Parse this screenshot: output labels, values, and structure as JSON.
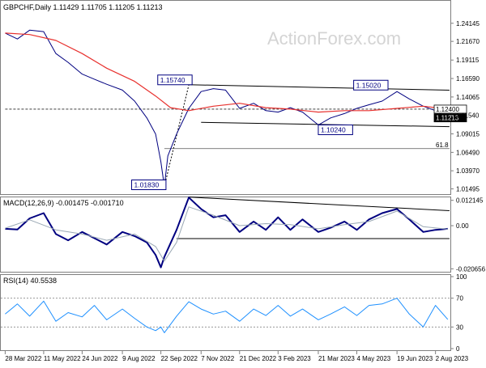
{
  "chart_data": [
    {
      "type": "line",
      "panel": "price",
      "title": "GBPCHF,Daily  1.11429 1.11705 1.11205 1.11213",
      "watermark": "ActionForex.com",
      "ylim": [
        1.01,
        1.26
      ],
      "y_ticks": [
        1.24145,
        1.2167,
        1.19115,
        1.1659,
        1.14065,
        1.1154,
        1.09015,
        1.0649,
        1.0397,
        1.01495
      ],
      "y_tick_labels": [
        "1.24145",
        "1.21670",
        "1.19115",
        "1.16590",
        "1.14065",
        "1.11540",
        "1.09015",
        "1.06490",
        "1.03970",
        "1.01495"
      ],
      "x_dates": [
        "28 Mar 2022",
        "11 May 2022",
        "24 Jun 2022",
        "9 Aug 2022",
        "22 Sep 2022",
        "7 Nov 2022",
        "21 Dec 2022",
        "3 Feb 2023",
        "21 Mar 2023",
        "4 May 2023",
        "19 Jun 2023",
        "2 Aug 2023"
      ],
      "series": [
        {
          "role": "close",
          "color": "#000080",
          "x": [
            "2022-03-28",
            "2022-04-11",
            "2022-04-25",
            "2022-05-11",
            "2022-05-25",
            "2022-06-08",
            "2022-06-24",
            "2022-07-08",
            "2022-07-22",
            "2022-08-09",
            "2022-08-23",
            "2022-09-06",
            "2022-09-16",
            "2022-09-22",
            "2022-09-26",
            "2022-09-30",
            "2022-10-10",
            "2022-10-24",
            "2022-11-07",
            "2022-11-21",
            "2022-12-05",
            "2022-12-21",
            "2023-01-06",
            "2023-01-20",
            "2023-02-03",
            "2023-02-17",
            "2023-03-03",
            "2023-03-21",
            "2023-04-04",
            "2023-04-20",
            "2023-05-04",
            "2023-05-18",
            "2023-06-02",
            "2023-06-19",
            "2023-07-03",
            "2023-07-19",
            "2023-08-02",
            "2023-08-16"
          ],
          "y": [
            1.228,
            1.22,
            1.232,
            1.23,
            1.2,
            1.188,
            1.172,
            1.165,
            1.158,
            1.15,
            1.135,
            1.112,
            1.09,
            1.052,
            1.0183,
            1.06,
            1.09,
            1.125,
            1.148,
            1.152,
            1.15,
            1.125,
            1.132,
            1.122,
            1.12,
            1.126,
            1.12,
            1.1024,
            1.112,
            1.118,
            1.125,
            1.13,
            1.135,
            1.148,
            1.138,
            1.128,
            1.122,
            1.1121
          ]
        },
        {
          "role": "moving average",
          "color": "#e8312e",
          "x": [
            "2022-03-28",
            "2022-04-25",
            "2022-05-25",
            "2022-06-24",
            "2022-07-22",
            "2022-08-23",
            "2022-09-16",
            "2022-10-03",
            "2022-10-24",
            "2022-11-21",
            "2022-12-21",
            "2023-01-20",
            "2023-02-17",
            "2023-03-21",
            "2023-04-20",
            "2023-05-18",
            "2023-06-19",
            "2023-07-19",
            "2023-08-16"
          ],
          "y": [
            1.228,
            1.226,
            1.218,
            1.2,
            1.18,
            1.162,
            1.142,
            1.126,
            1.122,
            1.128,
            1.132,
            1.126,
            1.124,
            1.12,
            1.122,
            1.122,
            1.125,
            1.128,
            1.124
          ]
        }
      ],
      "labels": [
        {
          "text": "1.15740",
          "date": "2022-10-24",
          "value": 1.1574
        },
        {
          "text": "1.01830",
          "date": "2022-09-26",
          "value": 1.0183
        },
        {
          "text": "1.15020",
          "date": "2023-06-05",
          "value": 1.1502
        },
        {
          "text": "1.10240",
          "date": "2023-03-21",
          "value": 1.1024
        },
        {
          "text": "61.8",
          "date": "2023-08-16",
          "value": 1.07
        }
      ],
      "price_tags": [
        {
          "text": "1.12400",
          "value": 1.124,
          "style": "light"
        },
        {
          "text": "1.11213",
          "value": 1.11213,
          "style": "dark"
        }
      ],
      "lines": [
        {
          "role": "channel-upper",
          "from": {
            "date": "2022-10-24",
            "value": 1.1574
          },
          "to": {
            "date": "2023-08-18",
            "value": 1.15
          }
        },
        {
          "role": "channel-lower",
          "from": {
            "date": "2022-11-07",
            "value": 1.106
          },
          "to": {
            "date": "2023-08-18",
            "value": 1.1
          }
        },
        {
          "role": "trend-support",
          "from": {
            "date": "2022-09-26",
            "value": 1.0183
          },
          "to": {
            "date": "2022-10-24",
            "value": 1.1574
          }
        },
        {
          "role": "fib-61.8",
          "from": {
            "date": "2022-09-26",
            "value": 1.07
          },
          "to": {
            "date": "2023-08-18",
            "value": 1.07
          }
        },
        {
          "role": "current-level",
          "from": {
            "date": "2022-03-28",
            "value": 1.124
          },
          "to": {
            "date": "2023-08-18",
            "value": 1.124
          }
        }
      ]
    },
    {
      "type": "line",
      "panel": "macd",
      "title": "MACD(12,26,9) -0.001475 -0.001710",
      "ylim": [
        -0.0213,
        0.0128
      ],
      "y_ticks": [
        0.012145,
        0.0,
        -0.020656
      ],
      "y_tick_labels": [
        "0.012145",
        "0.00",
        "-0.020656"
      ],
      "series": [
        {
          "role": "macd",
          "color": "#000080",
          "x": [
            "2022-03-28",
            "2022-04-11",
            "2022-04-25",
            "2022-05-11",
            "2022-05-25",
            "2022-06-08",
            "2022-06-24",
            "2022-07-08",
            "2022-07-22",
            "2022-08-09",
            "2022-08-23",
            "2022-09-06",
            "2022-09-16",
            "2022-09-22",
            "2022-09-26",
            "2022-10-10",
            "2022-10-24",
            "2022-11-07",
            "2022-11-21",
            "2022-12-05",
            "2022-12-21",
            "2023-01-06",
            "2023-01-20",
            "2023-02-03",
            "2023-02-17",
            "2023-03-03",
            "2023-03-21",
            "2023-04-04",
            "2023-04-20",
            "2023-05-04",
            "2023-05-18",
            "2023-06-02",
            "2023-06-19",
            "2023-07-03",
            "2023-07-19",
            "2023-08-02",
            "2023-08-16"
          ],
          "y": [
            -0.0015,
            -0.0018,
            0.0035,
            0.006,
            -0.004,
            -0.007,
            -0.003,
            -0.006,
            -0.009,
            -0.003,
            -0.005,
            -0.008,
            -0.014,
            -0.02,
            -0.015,
            -0.002,
            0.0135,
            0.008,
            0.004,
            0.005,
            -0.003,
            0.002,
            -0.002,
            0.004,
            -0.002,
            0.003,
            -0.003,
            -0.001,
            0.002,
            -0.002,
            0.003,
            0.006,
            0.008,
            0.003,
            -0.003,
            -0.002,
            -0.0015
          ]
        },
        {
          "role": "signal",
          "color": "#9aa8b4",
          "x": [
            "2022-03-28",
            "2022-04-25",
            "2022-05-25",
            "2022-06-24",
            "2022-07-22",
            "2022-08-23",
            "2022-09-16",
            "2022-09-26",
            "2022-10-10",
            "2022-10-24",
            "2022-11-21",
            "2022-12-21",
            "2023-01-20",
            "2023-02-17",
            "2023-03-21",
            "2023-04-20",
            "2023-05-18",
            "2023-06-19",
            "2023-07-19",
            "2023-08-16"
          ],
          "y": [
            -0.0012,
            0.0028,
            -0.002,
            -0.004,
            -0.007,
            -0.004,
            -0.01,
            -0.017,
            -0.008,
            0.009,
            0.005,
            0.0,
            0.001,
            0.0005,
            -0.0015,
            0.0005,
            0.002,
            0.007,
            -0.0005,
            -0.0017
          ]
        }
      ],
      "lines": [
        {
          "role": "macd-resistance",
          "from": {
            "date": "2022-10-24",
            "value": 0.0137
          },
          "to": {
            "date": "2023-08-18",
            "value": 0.0072
          }
        },
        {
          "role": "macd-support",
          "from": {
            "date": "2022-10-10",
            "value": -0.0062
          },
          "to": {
            "date": "2023-08-18",
            "value": -0.0062
          }
        }
      ]
    },
    {
      "type": "line",
      "panel": "rsi",
      "title": "RSI(14) 40.5538",
      "ylim": [
        0,
        100
      ],
      "y_ticks": [
        100,
        70,
        30,
        0
      ],
      "y_tick_labels": [
        "100",
        "70",
        "30",
        "0"
      ],
      "series": [
        {
          "role": "rsi",
          "color": "#1e90ff",
          "x": [
            "2022-03-28",
            "2022-04-11",
            "2022-04-25",
            "2022-05-11",
            "2022-05-25",
            "2022-06-08",
            "2022-06-24",
            "2022-07-08",
            "2022-07-22",
            "2022-08-09",
            "2022-08-23",
            "2022-09-06",
            "2022-09-16",
            "2022-09-22",
            "2022-09-26",
            "2022-10-10",
            "2022-10-24",
            "2022-11-07",
            "2022-11-21",
            "2022-12-05",
            "2022-12-21",
            "2023-01-06",
            "2023-01-20",
            "2023-02-03",
            "2023-02-17",
            "2023-03-03",
            "2023-03-21",
            "2023-04-04",
            "2023-04-20",
            "2023-05-04",
            "2023-05-18",
            "2023-06-02",
            "2023-06-19",
            "2023-07-03",
            "2023-07-19",
            "2023-08-02",
            "2023-08-16"
          ],
          "y": [
            48,
            62,
            45,
            66,
            38,
            50,
            44,
            60,
            40,
            55,
            42,
            30,
            25,
            30,
            22,
            45,
            65,
            55,
            48,
            52,
            38,
            55,
            46,
            60,
            45,
            55,
            40,
            48,
            58,
            46,
            60,
            62,
            70,
            48,
            30,
            60,
            40.5538
          ]
        }
      ]
    }
  ]
}
